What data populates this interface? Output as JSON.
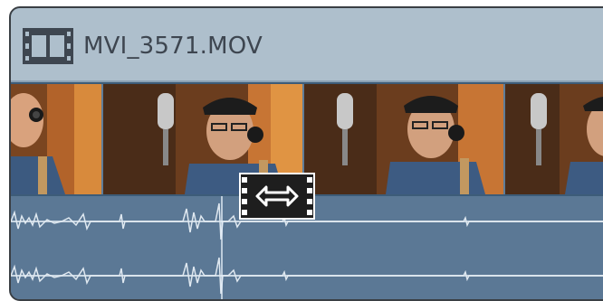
{
  "clip": {
    "name": "MVI_3571.MOV",
    "header_color": "#aebfcc",
    "body_color": "#5b7895",
    "icon": "film-strip-icon"
  },
  "thumbnails": [
    {
      "name": "thumb-1"
    },
    {
      "name": "thumb-2"
    },
    {
      "name": "thumb-3"
    },
    {
      "name": "thumb-4"
    }
  ],
  "trim_marker": {
    "icon": "slip-trim-icon"
  },
  "audio": {
    "channels": 2
  }
}
